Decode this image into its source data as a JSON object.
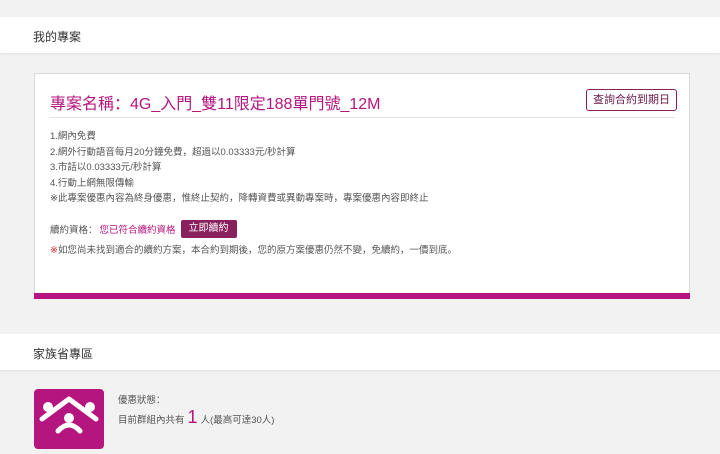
{
  "sections": {
    "my_plan": "我的專案",
    "family": "家族省專區"
  },
  "plan": {
    "title": "專案名稱：4G_入門_雙11限定188單門號_12M",
    "query_button": "查詢合約到期日",
    "features": [
      "1.網內免費",
      "2.網外行動語音每月20分鐘免費，超過以0.03333元/秒計算",
      "3.市話以0.03333元/秒計算",
      "4.行動上網無限傳輸",
      "※此專案優惠內容為終身優惠，惟終止契約，降轉資費或異動專案時，專案優惠內容即終止"
    ],
    "renew_label": "續約資格：",
    "renew_status": "您已符合續約資格",
    "renew_button": "立即續約",
    "note_mark": "※",
    "note_text": "如您尚未找到適合的續約方案，本合約到期後，您的原方案優惠仍然不變，免續約，一價到底。"
  },
  "family": {
    "status_label": "優惠狀態：",
    "count_prefix": "目前群組內共有",
    "count": "1",
    "count_suffix": "人(最高可達30人)",
    "colors": {
      "accent": "#b5157f"
    },
    "icon": "family-icon"
  }
}
